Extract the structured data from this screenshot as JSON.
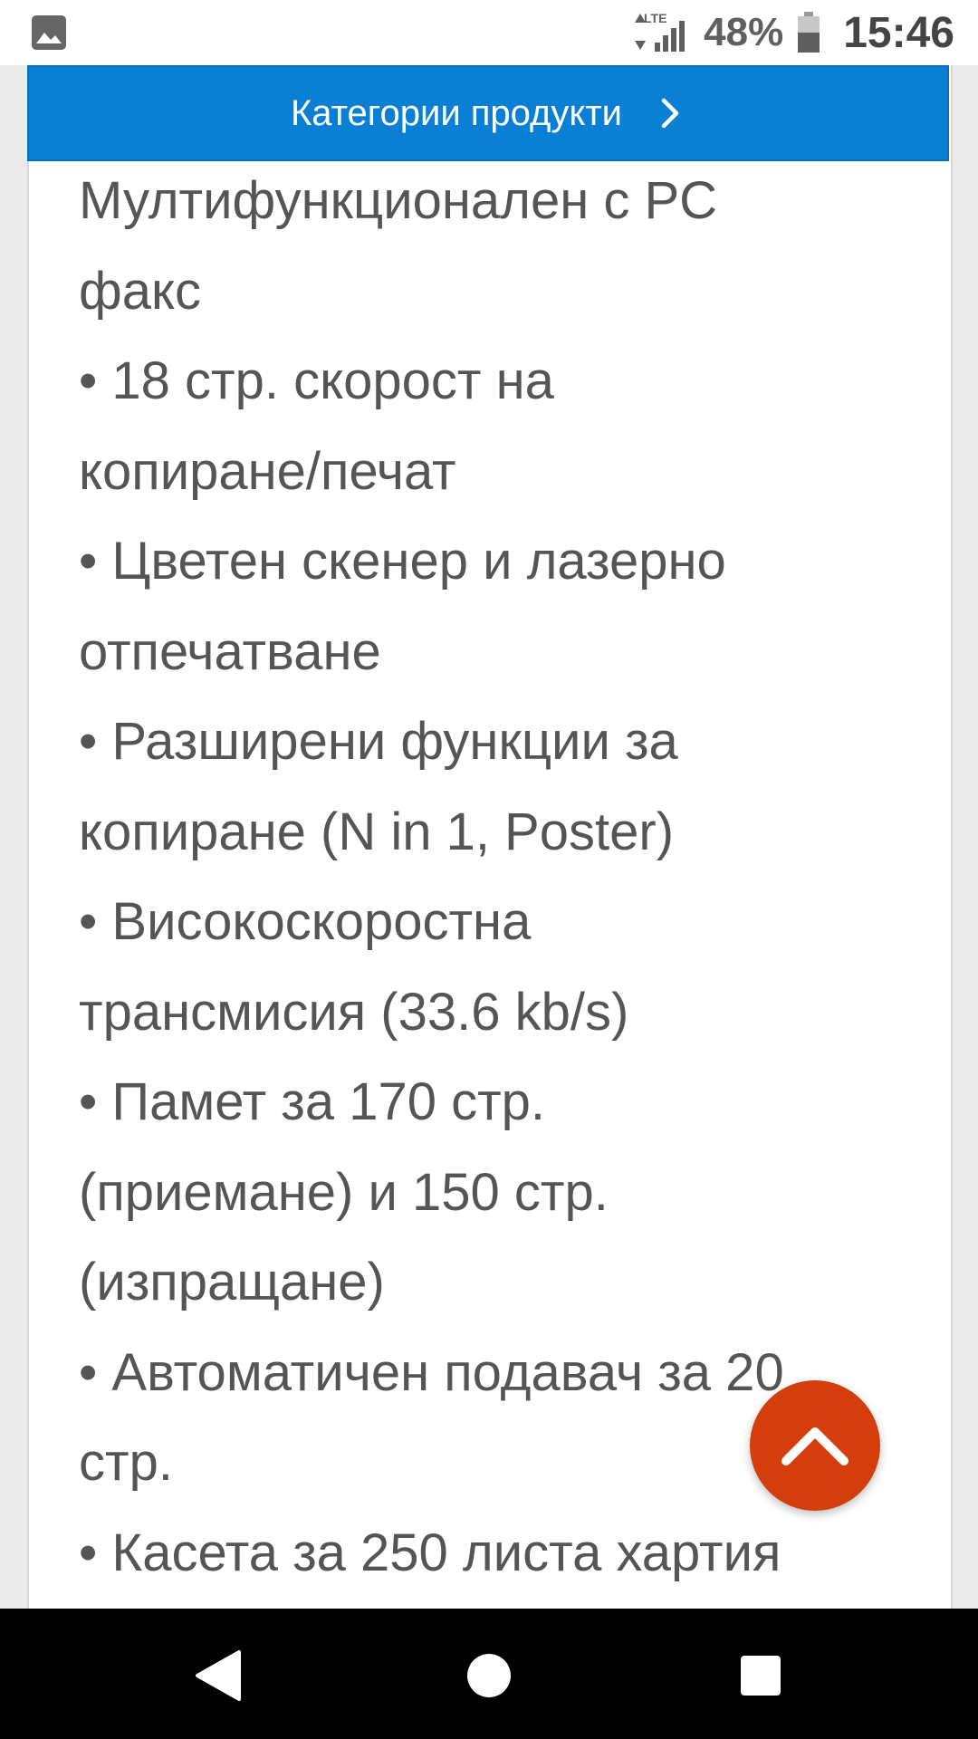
{
  "status_bar": {
    "network": "LTE",
    "battery_percent": "48%",
    "time": "15:46",
    "icons": [
      "gallery-icon",
      "lte-signal-icon",
      "battery-icon"
    ]
  },
  "header": {
    "category_label": "Категории продукти",
    "chevron_icon": "chevron-right-icon"
  },
  "description": {
    "lines": [
      "Мултифункционален с PC",
      "факс",
      "• 18 стр. скорост на",
      "копиране/печат",
      "• Цветен скенер и лазерно",
      "отпечатване",
      "• Разширени функции за",
      "копиране (N in 1, Poster)",
      "• Високоскоростна",
      "трансмисия (33.6 kb/s)",
      "• Памет за 170 стр.",
      "(приемане) и 150 стр.",
      "(изпращане)",
      "• Автоматичен подавач за 20",
      "стр.",
      "• Касета за 250 листа хартия"
    ]
  },
  "fab": {
    "icon": "chevron-up-icon",
    "color": "#d43e0c"
  },
  "colors": {
    "accent": "#0a7fd3",
    "text": "#555555",
    "fab": "#d43e0c"
  },
  "nav_bar": {
    "icons": [
      "back-icon",
      "home-icon",
      "recents-icon"
    ]
  }
}
